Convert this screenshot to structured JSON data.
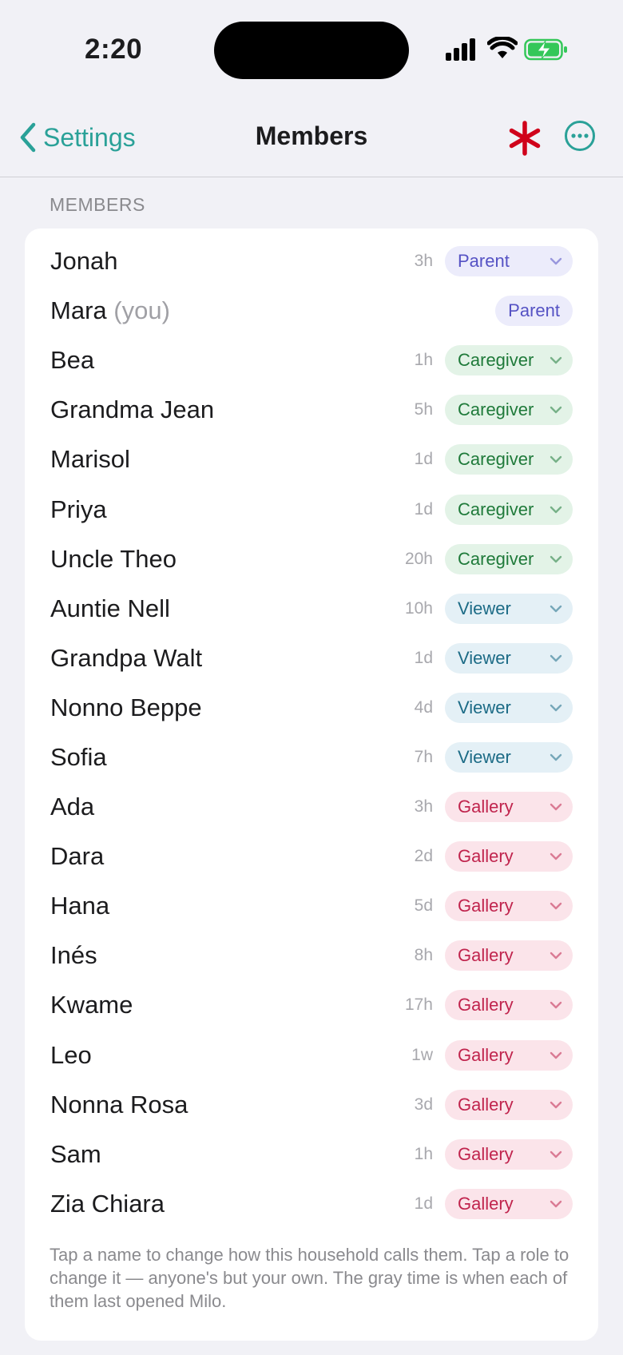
{
  "status_bar": {
    "time": "2:20"
  },
  "nav": {
    "back_label": "Settings",
    "title": "Members"
  },
  "section": {
    "header": "MEMBERS",
    "footer": "Tap a name to change how this household calls them. Tap a role to change it — anyone's but your own. The gray time is when each of them last opened Milo."
  },
  "members": [
    {
      "name": "Jonah",
      "suffix": "",
      "last_opened": "3h",
      "role": "Parent",
      "role_key": "parent",
      "editable": true
    },
    {
      "name": "Mara",
      "suffix": "(you)",
      "last_opened": "",
      "role": "Parent",
      "role_key": "parent",
      "editable": false
    },
    {
      "name": "Bea",
      "suffix": "",
      "last_opened": "1h",
      "role": "Caregiver",
      "role_key": "caregiver",
      "editable": true
    },
    {
      "name": "Grandma Jean",
      "suffix": "",
      "last_opened": "5h",
      "role": "Caregiver",
      "role_key": "caregiver",
      "editable": true
    },
    {
      "name": "Marisol",
      "suffix": "",
      "last_opened": "1d",
      "role": "Caregiver",
      "role_key": "caregiver",
      "editable": true
    },
    {
      "name": "Priya",
      "suffix": "",
      "last_opened": "1d",
      "role": "Caregiver",
      "role_key": "caregiver",
      "editable": true
    },
    {
      "name": "Uncle Theo",
      "suffix": "",
      "last_opened": "20h",
      "role": "Caregiver",
      "role_key": "caregiver",
      "editable": true
    },
    {
      "name": "Auntie Nell",
      "suffix": "",
      "last_opened": "10h",
      "role": "Viewer",
      "role_key": "viewer",
      "editable": true
    },
    {
      "name": "Grandpa Walt",
      "suffix": "",
      "last_opened": "1d",
      "role": "Viewer",
      "role_key": "viewer",
      "editable": true
    },
    {
      "name": "Nonno Beppe",
      "suffix": "",
      "last_opened": "4d",
      "role": "Viewer",
      "role_key": "viewer",
      "editable": true
    },
    {
      "name": "Sofia",
      "suffix": "",
      "last_opened": "7h",
      "role": "Viewer",
      "role_key": "viewer",
      "editable": true
    },
    {
      "name": "Ada",
      "suffix": "",
      "last_opened": "3h",
      "role": "Gallery",
      "role_key": "gallery",
      "editable": true
    },
    {
      "name": "Dara",
      "suffix": "",
      "last_opened": "2d",
      "role": "Gallery",
      "role_key": "gallery",
      "editable": true
    },
    {
      "name": "Hana",
      "suffix": "",
      "last_opened": "5d",
      "role": "Gallery",
      "role_key": "gallery",
      "editable": true
    },
    {
      "name": "Inés",
      "suffix": "",
      "last_opened": "8h",
      "role": "Gallery",
      "role_key": "gallery",
      "editable": true
    },
    {
      "name": "Kwame",
      "suffix": "",
      "last_opened": "17h",
      "role": "Gallery",
      "role_key": "gallery",
      "editable": true
    },
    {
      "name": "Leo",
      "suffix": "",
      "last_opened": "1w",
      "role": "Gallery",
      "role_key": "gallery",
      "editable": true
    },
    {
      "name": "Nonna Rosa",
      "suffix": "",
      "last_opened": "3d",
      "role": "Gallery",
      "role_key": "gallery",
      "editable": true
    },
    {
      "name": "Sam",
      "suffix": "",
      "last_opened": "1h",
      "role": "Gallery",
      "role_key": "gallery",
      "editable": true
    },
    {
      "name": "Zia Chiara",
      "suffix": "",
      "last_opened": "1d",
      "role": "Gallery",
      "role_key": "gallery",
      "editable": true
    }
  ],
  "icons": {
    "back": "chevron-left-icon",
    "asterisk": "asterisk-icon",
    "more": "more-icon",
    "role_dropdown": "chevron-down-icon"
  },
  "colors": {
    "accent": "#2aa198",
    "asterisk": "#d0021b",
    "parent": "#5552c4",
    "caregiver": "#1f7a3a",
    "viewer": "#1c6b86",
    "gallery": "#c0244d"
  }
}
